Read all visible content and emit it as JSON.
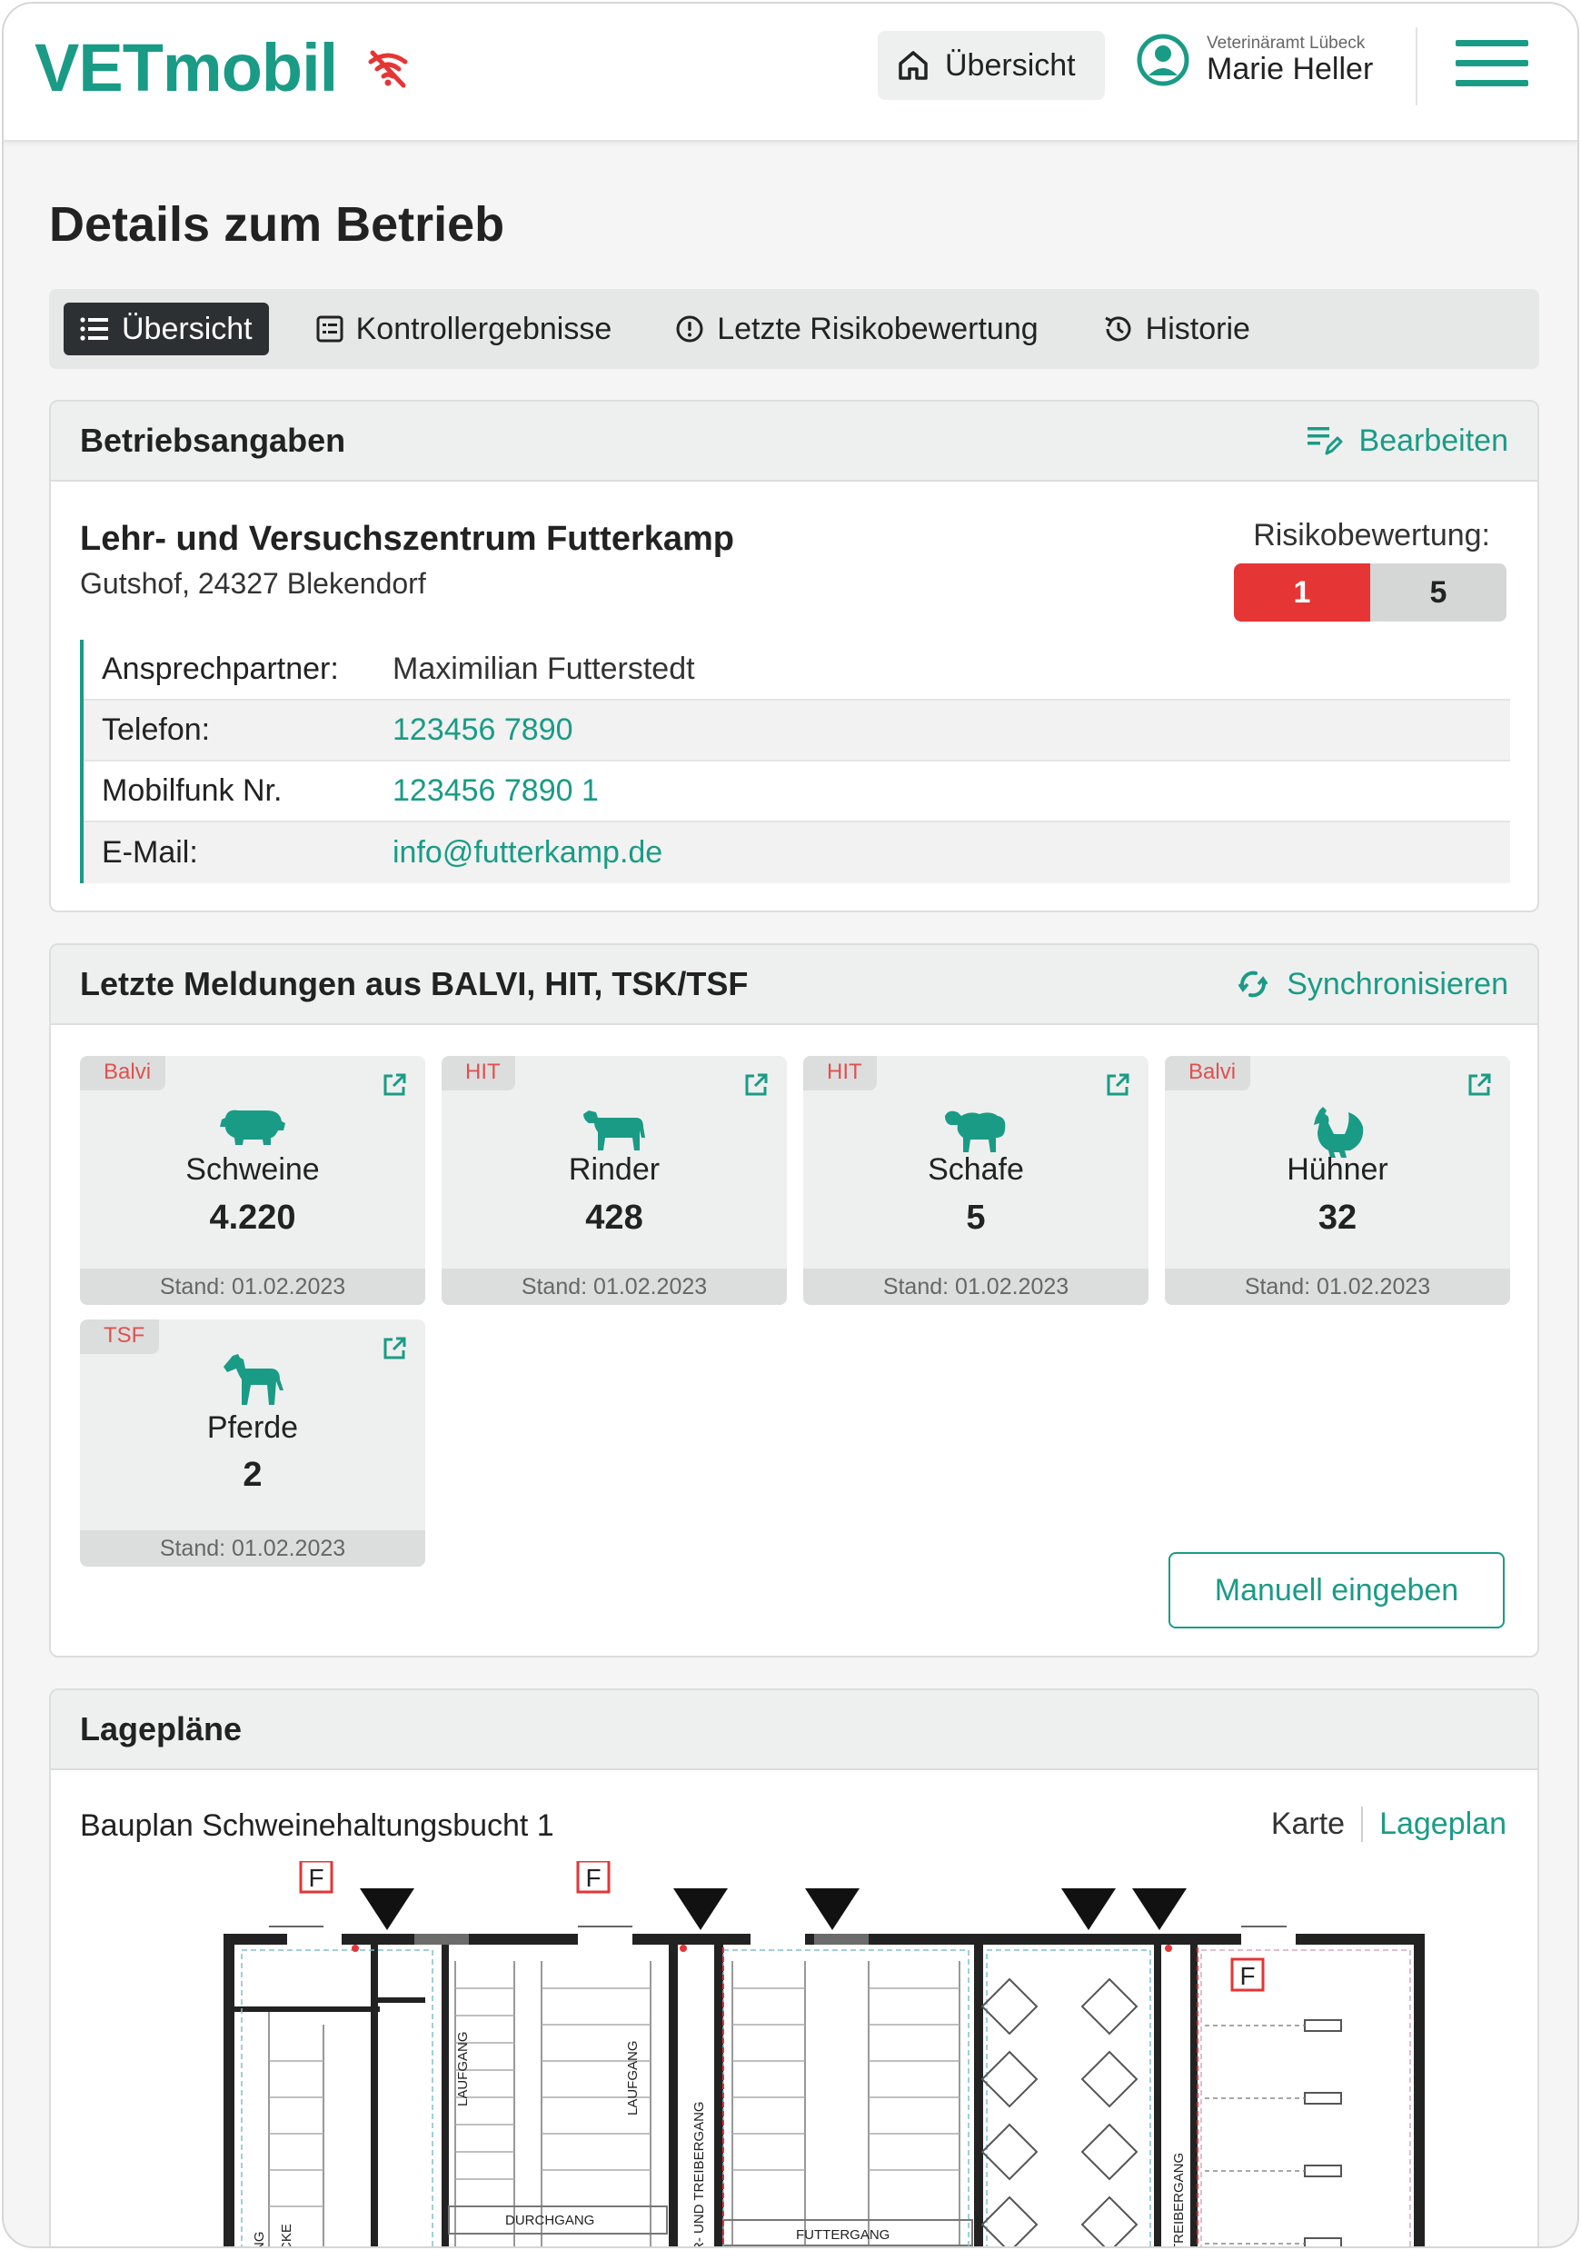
{
  "header": {
    "logo": "VETmobil",
    "nav_home_label": "Übersicht",
    "user_org": "Veterinäramt Lübeck",
    "user_name": "Marie Heller"
  },
  "page": {
    "title": "Details zum Betrieb"
  },
  "tabs": [
    {
      "label": "Übersicht",
      "active": true
    },
    {
      "label": "Kontrollergebnisse"
    },
    {
      "label": "Letzte Risikobewertung"
    },
    {
      "label": "Historie"
    }
  ],
  "betrieb": {
    "section_title": "Betriebsangaben",
    "edit_label": "Bearbeiten",
    "name": "Lehr- und Versuchszentrum Futterkamp",
    "address": "Gutshof, 24327 Blekendorf",
    "risk_label": "Risikobewertung:",
    "risk_current": "1",
    "risk_max": "5",
    "contacts": [
      {
        "key": "Ansprechpartner:",
        "value": "Maximilian Futterstedt"
      },
      {
        "key": "Telefon:",
        "value": "123456 7890"
      },
      {
        "key": "Mobilfunk Nr.",
        "value": "123456 7890 1"
      },
      {
        "key": "E-Mail:",
        "value": "info@futterkamp.de"
      }
    ]
  },
  "meldungen": {
    "section_title": "Letzte Meldungen aus BALVI, HIT, TSK/TSF",
    "sync_label": "Synchronisieren",
    "tiles": [
      {
        "source": "Balvi",
        "animal": "Schweine",
        "count": "4.220",
        "stand": "Stand: 01.02.2023",
        "icon": "pig-icon"
      },
      {
        "source": "HIT",
        "animal": "Rinder",
        "count": "428",
        "stand": "Stand: 01.02.2023",
        "icon": "cow-icon"
      },
      {
        "source": "HIT",
        "animal": "Schafe",
        "count": "5",
        "stand": "Stand: 01.02.2023",
        "icon": "sheep-icon"
      },
      {
        "source": "Balvi",
        "animal": "Hühner",
        "count": "32",
        "stand": "Stand: 01.02.2023",
        "icon": "chicken-icon"
      },
      {
        "source": "TSF",
        "animal": "Pferde",
        "count": "2",
        "stand": "Stand: 01.02.2023",
        "icon": "horse-icon"
      }
    ],
    "manual_button": "Manuell eingeben"
  },
  "lageplaene": {
    "section_title": "Lagepläne",
    "plan_title": "Bauplan Schweinehaltungsbucht 1",
    "view_karte": "Karte",
    "view_lageplan": "Lageplan",
    "labels": {
      "fire": "F",
      "laufgang": "LAUFGANG",
      "durchgang": "DURCHGANG",
      "futtergang": "FUTTERGANG",
      "treibergang": "TREIBERGANG",
      "futter_treibergang": "ER- UND TREIBERGANG",
      "gang": "ANG",
      "ecke": "ECKE"
    }
  },
  "colors": {
    "brand": "#1a9b86",
    "risk_red": "#e53535",
    "source_red": "#e05050"
  }
}
